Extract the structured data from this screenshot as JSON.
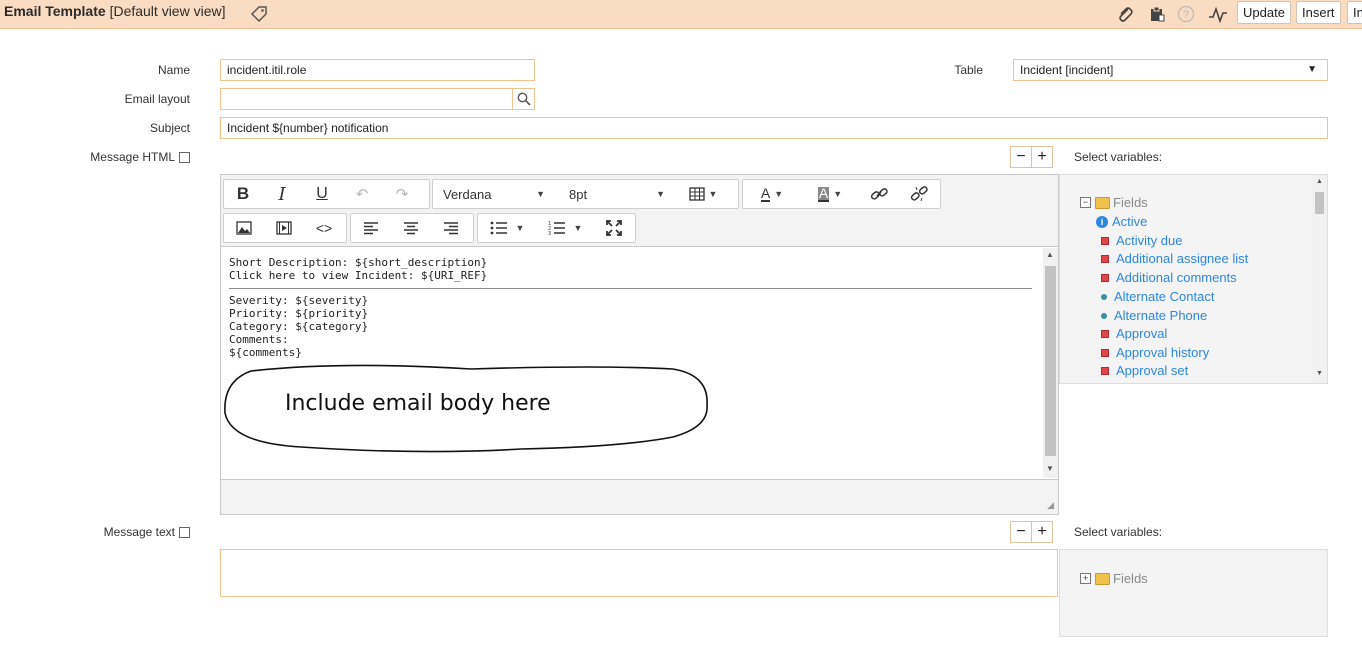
{
  "header": {
    "title": "Email Template",
    "subtitle": "[Default view view]",
    "buttons": {
      "update": "Update",
      "insert": "Insert",
      "insert_stay": "In"
    }
  },
  "form": {
    "name_label": "Name",
    "name_value": "incident.itil.role",
    "table_label": "Table",
    "table_value": "Incident [incident]",
    "email_layout_label": "Email layout",
    "email_layout_value": "",
    "subject_label": "Subject",
    "subject_value": "Incident ${number} notification",
    "message_html_label": "Message HTML",
    "message_text_label": "Message text",
    "select_variables_label": "Select variables:",
    "minus": "−",
    "plus": "+"
  },
  "editor": {
    "font": "Verdana",
    "size": "8pt",
    "content_lines_top": [
      "Short Description: ${short_description}",
      "Click here to view Incident: ${URI_REF}"
    ],
    "content_lines_bottom": [
      "Severity: ${severity}",
      "Priority: ${priority}",
      "Category: ${category}",
      "Comments:",
      "${comments}"
    ],
    "annotation": "Include email body here"
  },
  "variables": {
    "root": "Fields",
    "items": [
      {
        "label": "Active",
        "marker": "info"
      },
      {
        "label": "Activity due",
        "marker": "square"
      },
      {
        "label": "Additional assignee list",
        "marker": "square"
      },
      {
        "label": "Additional comments",
        "marker": "square"
      },
      {
        "label": "Alternate Contact",
        "marker": "dot"
      },
      {
        "label": "Alternate Phone",
        "marker": "dot"
      },
      {
        "label": "Approval",
        "marker": "square"
      },
      {
        "label": "Approval history",
        "marker": "square"
      },
      {
        "label": "Approval set",
        "marker": "square"
      }
    ],
    "text_root": "Fields"
  },
  "colors": {
    "header_bg": "#f9dcc1",
    "input_border": "#f0c48f",
    "link": "#2e86de"
  }
}
